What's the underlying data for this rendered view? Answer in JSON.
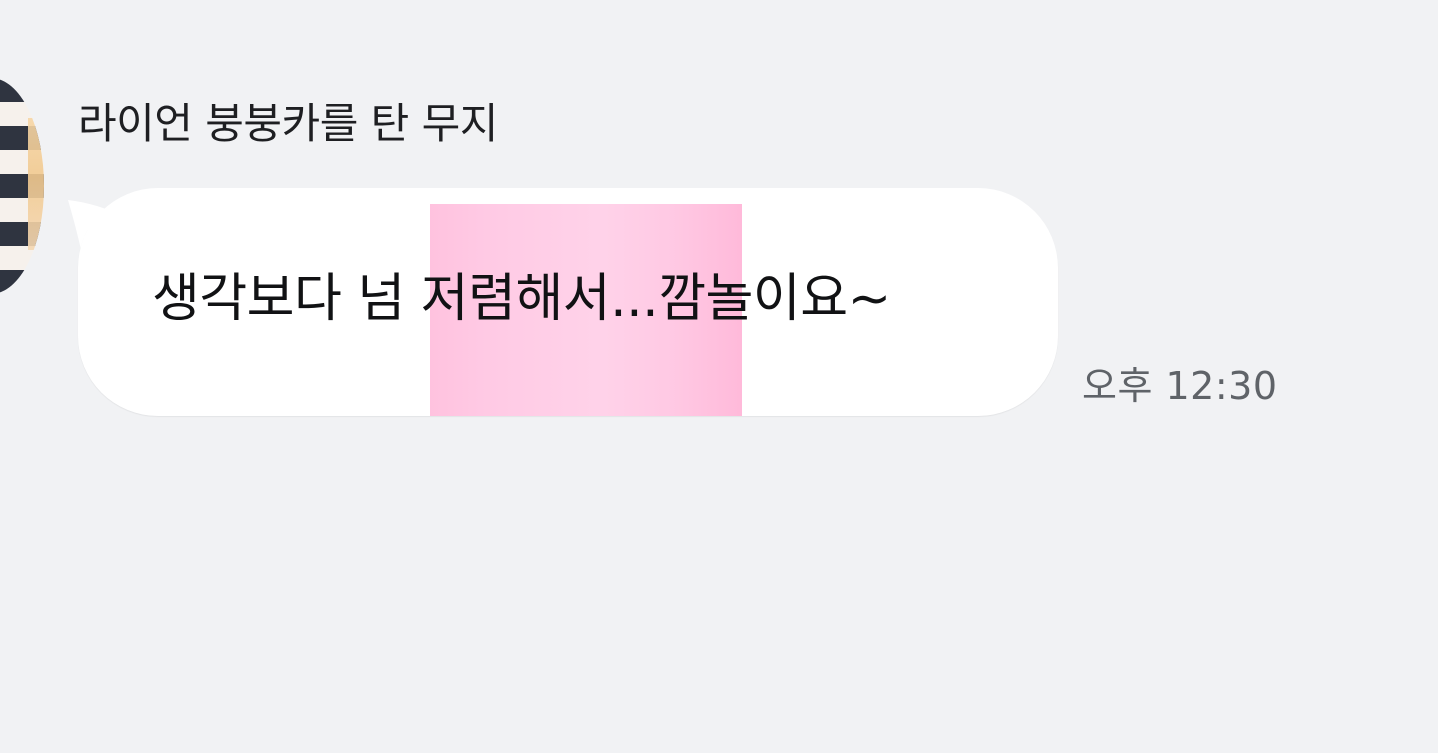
{
  "sender": {
    "name": "라이언 붕붕카를 탄 무지"
  },
  "message": {
    "text": "생각보다 넘 저렴해서...깜놀이요~",
    "time": "오후 12:30",
    "highlight_color": "#ffc6e2"
  },
  "colors": {
    "background": "#f1f2f4",
    "bubble": "#ffffff",
    "text": "#111214",
    "timestamp": "#5f6368"
  },
  "icons": {
    "avatar": "profile-avatar"
  }
}
